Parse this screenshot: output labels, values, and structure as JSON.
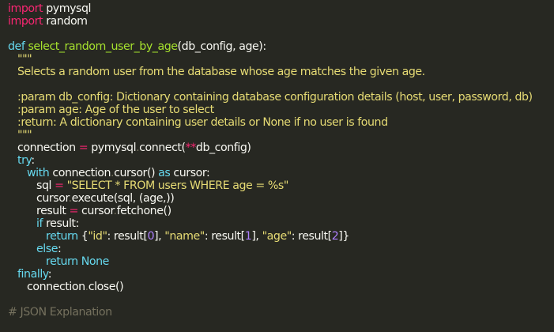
{
  "code": {
    "l1": {
      "kw": "import",
      "rest": " pymysql"
    },
    "l2": {
      "kw": "import",
      "rest": " random"
    },
    "l4": {
      "kw": "def",
      "fn": "select_random_user_by_age",
      "args": "(db_config, age):"
    },
    "l5": {
      "str": "\"\"\""
    },
    "l6": {
      "str": "Selects a random user from the database whose age matches the given age."
    },
    "l8": {
      "str": ":param db_config: Dictionary containing database configuration details (host, user, password, db)"
    },
    "l9": {
      "str": ":param age: Age of the user to select"
    },
    "l10": {
      "str": ":return: A dictionary containing user details or None if no user is found"
    },
    "l11": {
      "str": "\"\"\""
    },
    "l12": {
      "a": "connection ",
      "op1": "=",
      "b": " pymysql",
      "dot": ".",
      "c": "connect(",
      "op2": "**",
      "d": "db_config)"
    },
    "l13": {
      "kw": "try",
      "rest": ":"
    },
    "l14": {
      "kw1": "with",
      "a": " connection",
      "dot": ".",
      "b": "cursor() ",
      "kw2": "as",
      "c": " cursor:"
    },
    "l15": {
      "a": "sql ",
      "op": "=",
      "str": " \"SELECT * FROM users WHERE age = %s\""
    },
    "l16": {
      "a": "cursor",
      "dot": ".",
      "b": "execute(sql, (age,))"
    },
    "l17": {
      "a": "result ",
      "op": "=",
      "b": " cursor",
      "dot": ".",
      "c": "fetchone()"
    },
    "l18": {
      "kw": "if",
      "rest": " result:"
    },
    "l19": {
      "kw": "return",
      "p1": " {",
      "s1": "\"id\"",
      "p2": ": result[",
      "n1": "0",
      "p3": "], ",
      "s2": "\"name\"",
      "p4": ": result[",
      "n2": "1",
      "p5": "], ",
      "s3": "\"age\"",
      "p6": ": result[",
      "n3": "2",
      "p7": "]}"
    },
    "l20": {
      "kw": "else",
      "rest": ":"
    },
    "l21": {
      "kw1": "return",
      "kw2": " None"
    },
    "l22": {
      "kw": "finally",
      "rest": ":"
    },
    "l23": {
      "a": "connection",
      "dot": ".",
      "b": "close()"
    },
    "l25": {
      "cmt": "# JSON Explanation"
    }
  }
}
